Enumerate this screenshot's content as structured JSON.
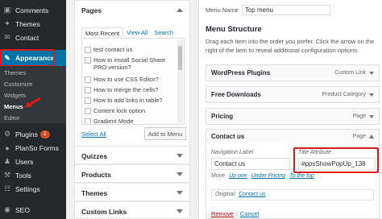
{
  "sidebar": {
    "comments": "Comments",
    "themes": "Themes",
    "contact": "Contact",
    "appearance": "Appearance",
    "submenu": [
      "Themes",
      "Customize",
      "Widgets",
      "Menus",
      "Editor"
    ],
    "plugins": "Plugins",
    "plugins_badge": "2",
    "planso": "PlanSo Forms",
    "users": "Users",
    "tools": "Tools",
    "settings": "Settings",
    "seo": "SEO"
  },
  "pages_panel": {
    "title": "Pages",
    "tabs": [
      "Most Recent",
      "View All",
      "Search"
    ],
    "items": [
      "test contact us",
      "How to install Social Share PRO version?",
      "How to use CSS Editor?",
      "How to merge the cells?",
      "How to add links in table?",
      "Content lock option",
      "Gradient Mode"
    ],
    "select_all": "Select All",
    "add_button": "Add to Menu"
  },
  "other_panels": [
    "Quizzes",
    "Products",
    "Themes",
    "Custom Links"
  ],
  "menu": {
    "name_label": "Menu Name",
    "name_value": "Top menu",
    "structure_title": "Menu Structure",
    "instructions": "Drag each item into the order you prefer. Click the arrow on the right of the item to reveal additional configuration options.",
    "items": [
      {
        "title": "WordPress Plugins",
        "type": "Custom Link"
      },
      {
        "title": "Free Downloads",
        "type": "Product Category"
      },
      {
        "title": "Pricing",
        "type": "Page"
      },
      {
        "title": "Contact us",
        "type": "Page"
      }
    ],
    "nav_label": "Navigation Label",
    "nav_value": "Contact us",
    "title_attr_label": "Title Attribute",
    "title_attr_value": "#ppsShowPopUp_138",
    "move_label": "Move",
    "move_links": [
      "Up one",
      "Under Pricing",
      "To the top"
    ],
    "original_label": "Original:",
    "original_link": "Contact us",
    "remove": "Remove",
    "separator": "|",
    "cancel": "Cancel"
  },
  "colors": {
    "sidebar_bg": "#23282d",
    "accent": "#0073aa",
    "highlight": "#dc1a1a"
  }
}
